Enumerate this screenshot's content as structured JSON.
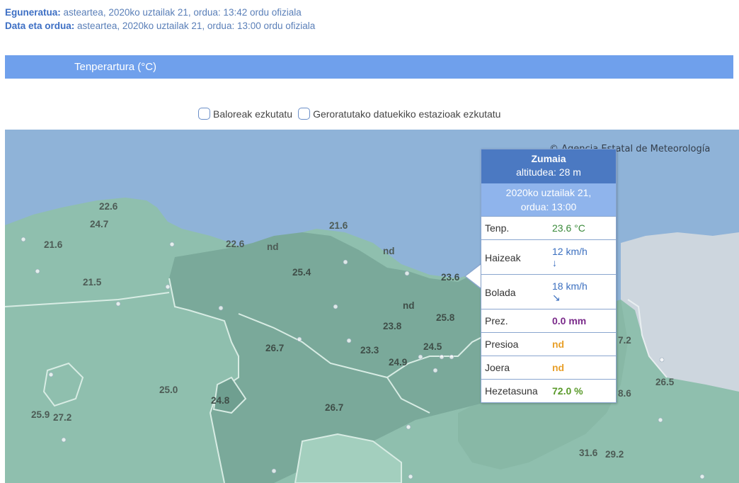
{
  "meta": {
    "updated_label": "Eguneratua:",
    "updated_value": "asteartea, 2020ko uztailak 21, ordua: 13:42 ordu ofiziala",
    "datetime_label": "Data eta ordua:",
    "datetime_value": "asteartea, 2020ko uztailak 21, ordua: 13:00 ordu ofiziala"
  },
  "band": {
    "title": "Tenperartura (°C)"
  },
  "checkboxes": {
    "hide_values": "Baloreak ezkutatu",
    "hide_late": "Geroratutako datuekiko estazioak ezkutatu"
  },
  "map": {
    "copyright": "© Agencia Estatal de Meteorología",
    "labels": [
      {
        "id": "l1",
        "text": "22.6"
      },
      {
        "id": "l2",
        "text": "24.7"
      },
      {
        "id": "l3",
        "text": "21.6"
      },
      {
        "id": "l4",
        "text": "21.5"
      },
      {
        "id": "l5",
        "text": "22.6"
      },
      {
        "id": "l6",
        "text": "nd"
      },
      {
        "id": "l7",
        "text": "21.6"
      },
      {
        "id": "l8",
        "text": "nd"
      },
      {
        "id": "l9",
        "text": "25.4"
      },
      {
        "id": "l10",
        "text": "23.6"
      },
      {
        "id": "l11",
        "text": "nd"
      },
      {
        "id": "l12",
        "text": "25.8"
      },
      {
        "id": "l13",
        "text": "23.8"
      },
      {
        "id": "l14",
        "text": "26.7"
      },
      {
        "id": "l15",
        "text": "23.3"
      },
      {
        "id": "l16",
        "text": "24.5"
      },
      {
        "id": "l17",
        "text": "24.9"
      },
      {
        "id": "l18",
        "text": "25.0"
      },
      {
        "id": "l19",
        "text": "24.8"
      },
      {
        "id": "l20",
        "text": "26.7"
      },
      {
        "id": "l21",
        "text": "25.9"
      },
      {
        "id": "l22",
        "text": "27.2"
      },
      {
        "id": "l23",
        "text": "7.2"
      },
      {
        "id": "l24",
        "text": "8.6"
      },
      {
        "id": "l25",
        "text": "26.5"
      },
      {
        "id": "l26",
        "text": "31.6"
      },
      {
        "id": "l27",
        "text": "29.2"
      }
    ]
  },
  "popup": {
    "station": "Zumaia",
    "altitude": "altitudea: 28 m",
    "date_line1": "2020ko uztailak 21,",
    "date_line2": "ordua: 13:00",
    "rows": {
      "temp_label": "Tenp.",
      "temp_value": "23.6 °C",
      "wind_label": "Haizeak",
      "wind_value": "12 km/h",
      "wind_arrow": "↓",
      "gust_label": "Bolada",
      "gust_value": "18 km/h",
      "gust_arrow": "↘",
      "prec_label": "Prez.",
      "prec_value": "0.0 mm",
      "pressure_label": "Presioa",
      "pressure_value": "nd",
      "trend_label": "Joera",
      "trend_value": "nd",
      "humidity_label": "Hezetasuna",
      "humidity_value": "72.0 %"
    }
  }
}
